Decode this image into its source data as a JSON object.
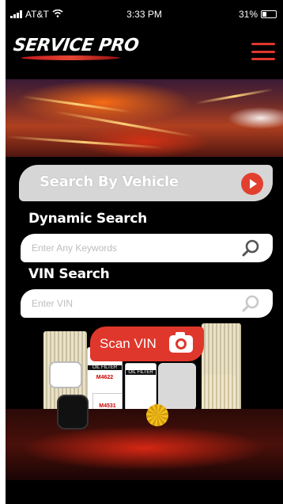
{
  "status_bar": {
    "carrier": "AT&T",
    "time": "3:33 PM",
    "battery": "31%"
  },
  "header": {
    "logo_text": "SERVICE PRO",
    "menu_icon": "hamburger-menu-icon"
  },
  "search": {
    "vehicle_button_label": "Search By Vehicle",
    "dynamic_label": "Dynamic Search",
    "dynamic_placeholder": "Enter Any Keywords",
    "vin_label": "VIN Search",
    "vin_placeholder": "Enter VIN",
    "scan_label": "Scan VIN"
  },
  "products": {
    "filter_label_1": "OIL FILTER",
    "filter_label_2": "OIL FILTER",
    "part_code_1": "M4622",
    "part_code_2": "M4531"
  },
  "colors": {
    "accent": "#e0372c",
    "background": "#000000"
  }
}
